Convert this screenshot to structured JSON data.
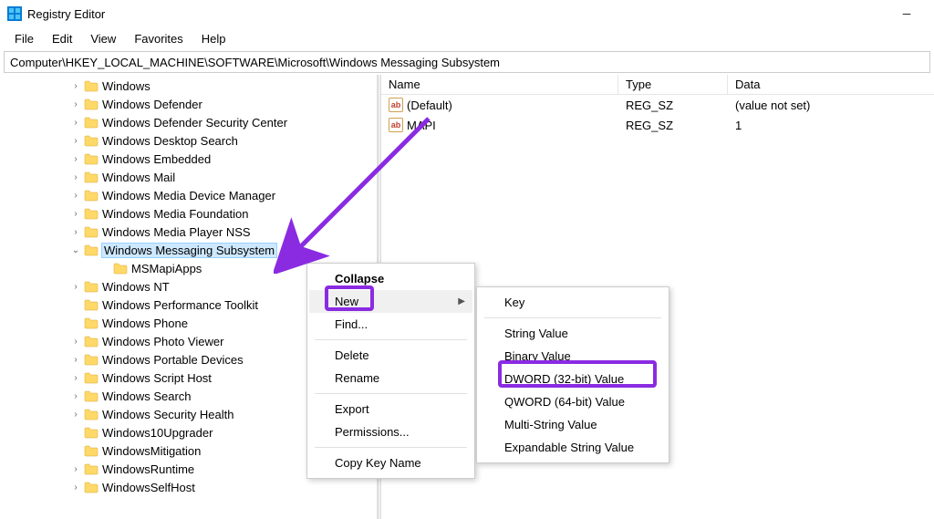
{
  "titlebar": {
    "title": "Registry Editor"
  },
  "menubar": {
    "items": [
      "File",
      "Edit",
      "View",
      "Favorites",
      "Help"
    ]
  },
  "addressbar": {
    "path": "Computer\\HKEY_LOCAL_MACHINE\\SOFTWARE\\Microsoft\\Windows Messaging Subsystem"
  },
  "tree": {
    "items": [
      {
        "label": "Windows",
        "chevron": ">",
        "depth": 0
      },
      {
        "label": "Windows Defender",
        "chevron": ">",
        "depth": 0
      },
      {
        "label": "Windows Defender Security Center",
        "chevron": ">",
        "depth": 0
      },
      {
        "label": "Windows Desktop Search",
        "chevron": ">",
        "depth": 0
      },
      {
        "label": "Windows Embedded",
        "chevron": ">",
        "depth": 0
      },
      {
        "label": "Windows Mail",
        "chevron": ">",
        "depth": 0
      },
      {
        "label": "Windows Media Device Manager",
        "chevron": ">",
        "depth": 0
      },
      {
        "label": "Windows Media Foundation",
        "chevron": ">",
        "depth": 0
      },
      {
        "label": "Windows Media Player NSS",
        "chevron": ">",
        "depth": 0
      },
      {
        "label": "Windows Messaging Subsystem",
        "chevron": "v",
        "depth": 0,
        "selected": true
      },
      {
        "label": "MSMapiApps",
        "chevron": "",
        "depth": 1
      },
      {
        "label": "Windows NT",
        "chevron": ">",
        "depth": 0
      },
      {
        "label": "Windows Performance Toolkit",
        "chevron": "",
        "depth": 0
      },
      {
        "label": "Windows Phone",
        "chevron": "",
        "depth": 0
      },
      {
        "label": "Windows Photo Viewer",
        "chevron": ">",
        "depth": 0
      },
      {
        "label": "Windows Portable Devices",
        "chevron": ">",
        "depth": 0
      },
      {
        "label": "Windows Script Host",
        "chevron": ">",
        "depth": 0
      },
      {
        "label": "Windows Search",
        "chevron": ">",
        "depth": 0
      },
      {
        "label": "Windows Security Health",
        "chevron": ">",
        "depth": 0
      },
      {
        "label": "Windows10Upgrader",
        "chevron": "",
        "depth": 0
      },
      {
        "label": "WindowsMitigation",
        "chevron": "",
        "depth": 0
      },
      {
        "label": "WindowsRuntime",
        "chevron": ">",
        "depth": 0
      },
      {
        "label": "WindowsSelfHost",
        "chevron": ">",
        "depth": 0
      }
    ]
  },
  "list": {
    "headers": {
      "name": "Name",
      "type": "Type",
      "data": "Data"
    },
    "rows": [
      {
        "name": "(Default)",
        "type": "REG_SZ",
        "data": "(value not set)"
      },
      {
        "name": "MAPI",
        "type": "REG_SZ",
        "data": "1"
      }
    ]
  },
  "context_menu": {
    "items": [
      {
        "label": "Collapse",
        "bold": true
      },
      {
        "label": "New",
        "hover": true,
        "arrow": true
      },
      {
        "label": "Find..."
      },
      {
        "sep": true
      },
      {
        "label": "Delete"
      },
      {
        "label": "Rename"
      },
      {
        "sep": true
      },
      {
        "label": "Export"
      },
      {
        "label": "Permissions..."
      },
      {
        "sep": true
      },
      {
        "label": "Copy Key Name"
      }
    ]
  },
  "submenu": {
    "items": [
      {
        "label": "Key"
      },
      {
        "sep": true
      },
      {
        "label": "String Value"
      },
      {
        "label": "Binary Value"
      },
      {
        "label": "DWORD (32-bit) Value"
      },
      {
        "label": "QWORD (64-bit) Value"
      },
      {
        "label": "Multi-String Value"
      },
      {
        "label": "Expandable String Value"
      }
    ]
  }
}
